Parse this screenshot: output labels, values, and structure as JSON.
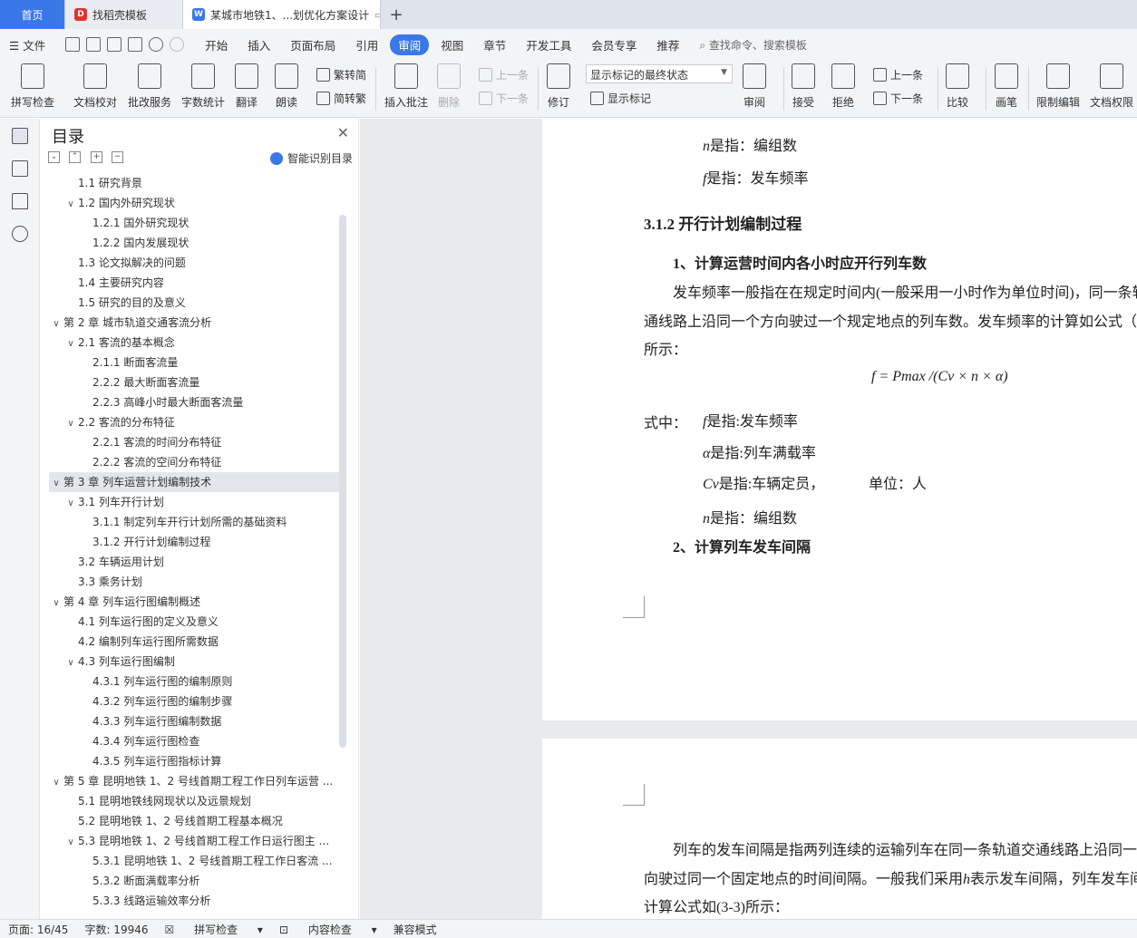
{
  "tabs": {
    "home": "首页",
    "template": "找稻壳模板",
    "doc": "某城市地铁1、...划优化方案设计",
    "doc_icon": "W",
    "template_icon": "D"
  },
  "menu": {
    "file": "文件",
    "items": [
      "开始",
      "插入",
      "页面布局",
      "引用",
      "审阅",
      "视图",
      "章节",
      "开发工具",
      "会员专享",
      "推荐"
    ],
    "search": "查找命令、搜索模板"
  },
  "ribbon": {
    "spell": "拼写检查",
    "proof": "文档校对",
    "revise_service": "批改服务",
    "word_count": "字数统计",
    "translate": "翻译",
    "read_aloud": "朗读",
    "trad": "繁转简",
    "simp": "简转繁",
    "insert_comment": "插入批注",
    "delete": "删除",
    "prev_comment": "上一条",
    "next_comment": "下一条",
    "track": "修订",
    "markup_state": "显示标记的最终状态",
    "show_markup": "显示标记",
    "review": "审阅",
    "accept": "接受",
    "reject": "拒绝",
    "prev_change": "上一条",
    "next_change": "下一条",
    "compare": "比较",
    "pen": "画笔",
    "restrict": "限制编辑",
    "permission": "文档权限"
  },
  "nav": {
    "title": "目录",
    "smart": "智能识别目录",
    "items": [
      {
        "text": "1.1 研究背景",
        "level": 1,
        "caret": ""
      },
      {
        "text": "1.2 国内外研究现状",
        "level": 1,
        "caret": "v"
      },
      {
        "text": "1.2.1 国外研究现状",
        "level": 2,
        "caret": ""
      },
      {
        "text": "1.2.2 国内发展现状",
        "level": 2,
        "caret": ""
      },
      {
        "text": "1.3 论文拟解决的问题",
        "level": 1,
        "caret": ""
      },
      {
        "text": "1.4 主要研究内容",
        "level": 1,
        "caret": ""
      },
      {
        "text": "1.5 研究的目的及意义",
        "level": 1,
        "caret": ""
      },
      {
        "text": "第 2 章  城市轨道交通客流分析",
        "level": 0,
        "caret": "v"
      },
      {
        "text": "2.1 客流的基本概念",
        "level": 1,
        "caret": "v"
      },
      {
        "text": "2.1.1 断面客流量",
        "level": 2,
        "caret": ""
      },
      {
        "text": "2.2.2 最大断面客流量",
        "level": 2,
        "caret": ""
      },
      {
        "text": "2.2.3 高峰小时最大断面客流量",
        "level": 2,
        "caret": ""
      },
      {
        "text": "2.2 客流的分布特征",
        "level": 1,
        "caret": "v"
      },
      {
        "text": "2.2.1 客流的时间分布特征",
        "level": 2,
        "caret": ""
      },
      {
        "text": "2.2.2 客流的空间分布特征",
        "level": 2,
        "caret": ""
      },
      {
        "text": "第 3 章  列车运营计划编制技术",
        "level": 0,
        "caret": "v",
        "selected": true
      },
      {
        "text": "3.1 列车开行计划",
        "level": 1,
        "caret": "v"
      },
      {
        "text": "3.1.1 制定列车开行计划所需的基础资料",
        "level": 2,
        "caret": ""
      },
      {
        "text": "3.1.2 开行计划编制过程",
        "level": 2,
        "caret": ""
      },
      {
        "text": "3.2 车辆运用计划",
        "level": 1,
        "caret": ""
      },
      {
        "text": "3.3 乘务计划",
        "level": 1,
        "caret": ""
      },
      {
        "text": "第 4 章  列车运行图编制概述",
        "level": 0,
        "caret": "v"
      },
      {
        "text": "4.1 列车运行图的定义及意义",
        "level": 1,
        "caret": ""
      },
      {
        "text": "4.2 编制列车运行图所需数据",
        "level": 1,
        "caret": ""
      },
      {
        "text": "4.3 列车运行图编制",
        "level": 1,
        "caret": "v"
      },
      {
        "text": "4.3.1 列车运行图的编制原则",
        "level": 2,
        "caret": ""
      },
      {
        "text": "4.3.2 列车运行图的编制步骤",
        "level": 2,
        "caret": ""
      },
      {
        "text": "4.3.3 列车运行图编制数据",
        "level": 2,
        "caret": ""
      },
      {
        "text": "4.3.4 列车运行图检查",
        "level": 2,
        "caret": ""
      },
      {
        "text": "4.3.5 列车运行图指标计算",
        "level": 2,
        "caret": ""
      },
      {
        "text": "第 5 章  昆明地铁 1、2 号线首期工程工作日列车运营 ...",
        "level": 0,
        "caret": "v"
      },
      {
        "text": "5.1 昆明地铁线网现状以及远景规划",
        "level": 1,
        "caret": ""
      },
      {
        "text": "5.2 昆明地铁 1、2 号线首期工程基本概况",
        "level": 1,
        "caret": ""
      },
      {
        "text": "5.3 昆明地铁 1、2 号线首期工程工作日运行图主 ...",
        "level": 1,
        "caret": "v"
      },
      {
        "text": "5.3.1 昆明地铁 1、2 号线首期工程工作日客流 ...",
        "level": 2,
        "caret": ""
      },
      {
        "text": "5.3.2 断面满载率分析",
        "level": 2,
        "caret": ""
      },
      {
        "text": "5.3.3 线路运输效率分析",
        "level": 2,
        "caret": ""
      }
    ]
  },
  "doc": {
    "n_var": "n",
    "n_def": "是指：编组数",
    "f_var": "f",
    "f_def": "是指：发车频率",
    "heading_312": "3.1.2 开行计划编制过程",
    "step1": "1、计算运营时间内各小时应开行列车数",
    "para1_l1": "发车频率一般指在在规定时间内(一般采用一小时作为单位时间)，同一条轨",
    "para1_l2": "通线路上沿同一个方向驶过一个规定地点的列车数。发车频率的计算如公式（",
    "para1_l3": "所示：",
    "formula": "f = Pmax /(Cv × n × α)",
    "where": "式中：",
    "def_f": "是指:发车频率",
    "alpha_var": "α",
    "def_alpha": "是指:列车满载率",
    "cv_var": "Cv",
    "def_cv": "是指:车辆定员，",
    "unit": "单位：人",
    "def_n": "是指：编组数",
    "step2": "2、计算列车发车间隔",
    "p2_l1": "列车的发车间隔是指两列连续的运输列车在同一条轨道交通线路上沿同一",
    "p2_l2a": "向驶过同一个固定地点的时间间隔。一般我们采用",
    "p2_h": "h",
    "p2_l2b": "表示发车间隔，列车发车间",
    "p2_l3": "计算公式如(3-3)所示："
  },
  "status": {
    "page": "页面: 16/45",
    "words": "字数: 19946",
    "spell": "拼写检查",
    "content": "内容检查",
    "compat": "兼容模式"
  }
}
